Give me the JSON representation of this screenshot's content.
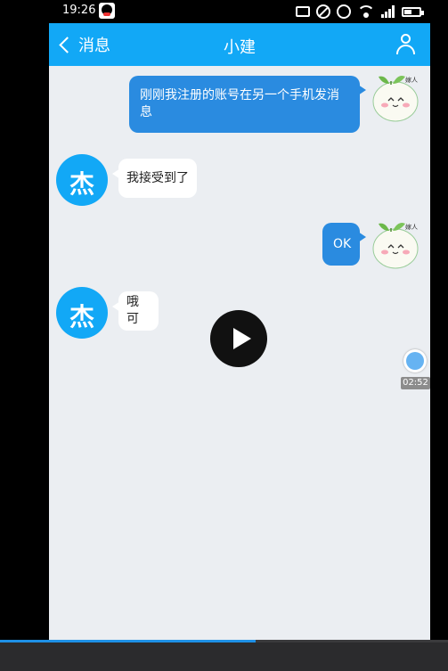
{
  "status_bar": {
    "time": "19:26"
  },
  "header": {
    "back_label": "消息",
    "title": "小建"
  },
  "messages": [
    {
      "side": "out",
      "text": "刚刚我注册的账号在另一个手机发消息"
    },
    {
      "side": "in",
      "text": "我接受到了"
    },
    {
      "side": "out",
      "text": "OK"
    },
    {
      "side": "in",
      "text": "哦可"
    }
  ],
  "contact": {
    "avatar_text": "杰"
  },
  "video": {
    "elapsed": "02:52",
    "progress": 0.57
  },
  "colors": {
    "accent": "#12a8f6",
    "outgoing_bubble": "#2a8be0",
    "chat_bg": "#ebeef2"
  },
  "icons": [
    "qq-icon",
    "cast-icon",
    "dnd-icon",
    "alarm-icon",
    "wifi-icon",
    "signal-icon",
    "battery-icon",
    "back-chevron-icon",
    "contact-icon",
    "play-icon"
  ]
}
